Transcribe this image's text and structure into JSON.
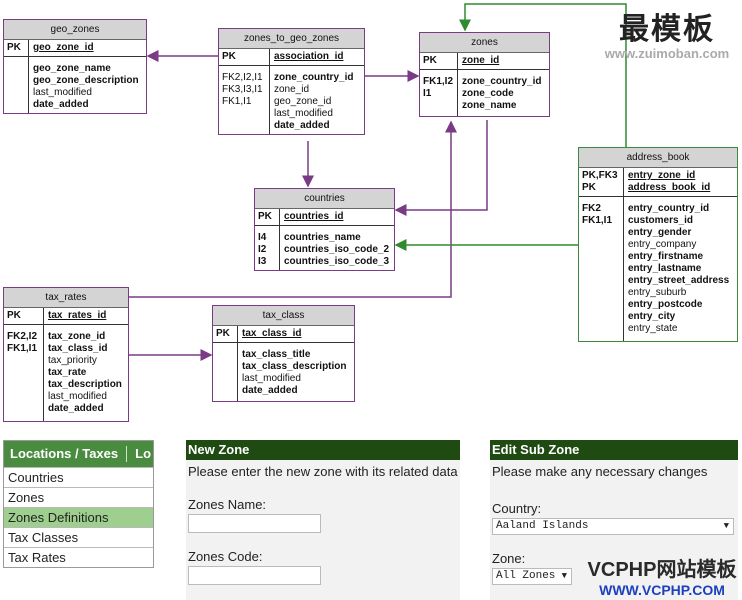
{
  "tables": {
    "geo_zones": {
      "title": "geo_zones",
      "pk_key": "PK",
      "pk_col": "geo_zone_id",
      "cols": [
        "geo_zone_name",
        "geo_zone_description",
        "last_modified",
        "date_added"
      ]
    },
    "zones_to_geo_zones": {
      "title": "zones_to_geo_zones",
      "pk_key": "PK",
      "pk_col": "association_id",
      "fk_keys": [
        "FK2,I2,I1",
        "FK3,I3,I1",
        "FK1,I1"
      ],
      "cols": [
        "zone_country_id",
        "zone_id",
        "geo_zone_id",
        "last_modified",
        "date_added"
      ]
    },
    "zones": {
      "title": "zones",
      "pk_key": "PK",
      "pk_col": "zone_id",
      "fk_keys": [
        "FK1,I2",
        "I1"
      ],
      "cols": [
        "zone_country_id",
        "zone_code",
        "zone_name"
      ]
    },
    "countries": {
      "title": "countries",
      "pk_key": "PK",
      "pk_col": "countries_id",
      "fk_keys": [
        "I4",
        "I2",
        "I3"
      ],
      "cols": [
        "countries_name",
        "countries_iso_code_2",
        "countries_iso_code_3"
      ]
    },
    "address_book": {
      "title": "address_book",
      "pk_keys": [
        "PK,FK3",
        "PK"
      ],
      "pk_cols": [
        "entry_zone_id",
        "address_book_id"
      ],
      "fk_keys": [
        "FK2",
        "FK1,I1"
      ],
      "cols": [
        "entry_country_id",
        "customers_id",
        "entry_gender",
        "entry_company",
        "entry_firstname",
        "entry_lastname",
        "entry_street_address",
        "entry_suburb",
        "entry_postcode",
        "entry_city",
        "entry_state"
      ]
    },
    "tax_rates": {
      "title": "tax_rates",
      "pk_key": "PK",
      "pk_col": "tax_rates_id",
      "fk_keys": [
        "FK2,I2",
        "FK1,I1"
      ],
      "cols": [
        "tax_zone_id",
        "tax_class_id",
        "tax_priority",
        "tax_rate",
        "tax_description",
        "last_modified",
        "date_added"
      ]
    },
    "tax_class": {
      "title": "tax_class",
      "pk_key": "PK",
      "pk_col": "tax_class_id",
      "cols": [
        "tax_class_title",
        "tax_class_description",
        "last_modified",
        "date_added"
      ]
    }
  },
  "colors": {
    "relation_purple": "#7a3a86",
    "relation_green": "#2e8b2e",
    "sidebar_green": "#4a8c3f",
    "panel_dark": "#1f4a12"
  },
  "watermark_top": {
    "big": "最模板",
    "small": "www.zuimoban.com"
  },
  "watermark_bottom": {
    "big": "VCPHP网站模板",
    "small": "WWW.VCPHP.COM"
  },
  "sidebar": {
    "title": "Locations / Taxes",
    "title_cut": "Lo",
    "items": [
      {
        "label": "Countries"
      },
      {
        "label": "Zones"
      },
      {
        "label": "Zones Definitions"
      },
      {
        "label": "Tax Classes"
      },
      {
        "label": "Tax Rates"
      }
    ]
  },
  "new_zone": {
    "title": "New Zone",
    "intro": "Please enter the new zone with its related data",
    "name_label": "Zones Name:",
    "code_label": "Zones Code:"
  },
  "edit_sub_zone": {
    "title": "Edit Sub Zone",
    "intro": "Please make any necessary changes",
    "country_label": "Country:",
    "country_value": "Aaland Islands",
    "zone_label": "Zone:",
    "zone_value": "All Zones"
  }
}
